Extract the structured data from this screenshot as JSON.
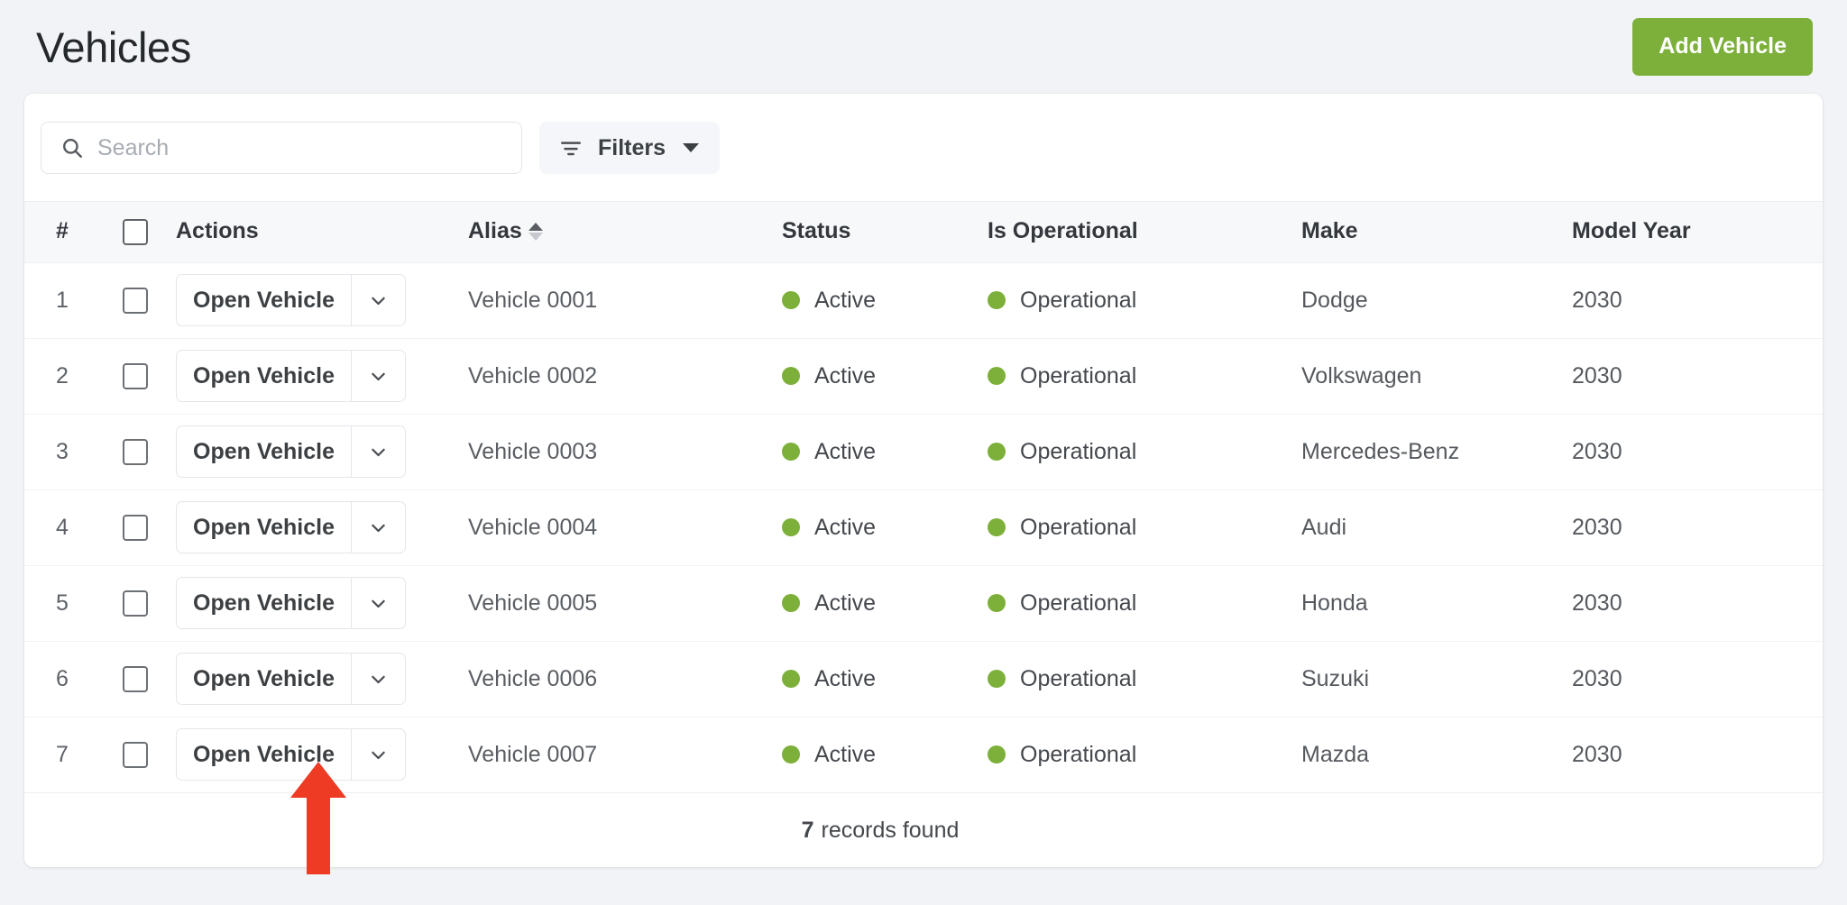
{
  "header": {
    "title": "Vehicles",
    "add_button_label": "Add Vehicle",
    "accent_green": "#7db03a"
  },
  "toolbar": {
    "search_placeholder": "Search",
    "search_value": "",
    "search_icon": "search-icon",
    "filters_label": "Filters",
    "filters_icon": "filter-icon",
    "filters_caret_icon": "caret-down-icon"
  },
  "table": {
    "columns": [
      {
        "key": "num",
        "label": "#"
      },
      {
        "key": "check",
        "label": ""
      },
      {
        "key": "action",
        "label": "Actions"
      },
      {
        "key": "alias",
        "label": "Alias",
        "sorted": "asc"
      },
      {
        "key": "status",
        "label": "Status"
      },
      {
        "key": "oper",
        "label": "Is Operational"
      },
      {
        "key": "make",
        "label": "Make"
      },
      {
        "key": "year",
        "label": "Model Year"
      }
    ],
    "row_action_label": "Open Vehicle",
    "rows": [
      {
        "num": "1",
        "alias": "Vehicle 0001",
        "status": "Active",
        "status_color": "#7db03a",
        "operational": "Operational",
        "operational_color": "#7db03a",
        "make": "Dodge",
        "year": "2030"
      },
      {
        "num": "2",
        "alias": "Vehicle 0002",
        "status": "Active",
        "status_color": "#7db03a",
        "operational": "Operational",
        "operational_color": "#7db03a",
        "make": "Volkswagen",
        "year": "2030"
      },
      {
        "num": "3",
        "alias": "Vehicle 0003",
        "status": "Active",
        "status_color": "#7db03a",
        "operational": "Operational",
        "operational_color": "#7db03a",
        "make": "Mercedes-Benz",
        "year": "2030"
      },
      {
        "num": "4",
        "alias": "Vehicle 0004",
        "status": "Active",
        "status_color": "#7db03a",
        "operational": "Operational",
        "operational_color": "#7db03a",
        "make": "Audi",
        "year": "2030"
      },
      {
        "num": "5",
        "alias": "Vehicle 0005",
        "status": "Active",
        "status_color": "#7db03a",
        "operational": "Operational",
        "operational_color": "#7db03a",
        "make": "Honda",
        "year": "2030"
      },
      {
        "num": "6",
        "alias": "Vehicle 0006",
        "status": "Active",
        "status_color": "#7db03a",
        "operational": "Operational",
        "operational_color": "#7db03a",
        "make": "Suzuki",
        "year": "2030"
      },
      {
        "num": "7",
        "alias": "Vehicle 0007",
        "status": "Active",
        "status_color": "#7db03a",
        "operational": "Operational",
        "operational_color": "#7db03a",
        "make": "Mazda",
        "year": "2030"
      }
    ]
  },
  "footer": {
    "records_count": "7",
    "records_label": "records found"
  },
  "annotation": {
    "arrow_color": "#ed3b24",
    "points_at": "Open Vehicle"
  }
}
